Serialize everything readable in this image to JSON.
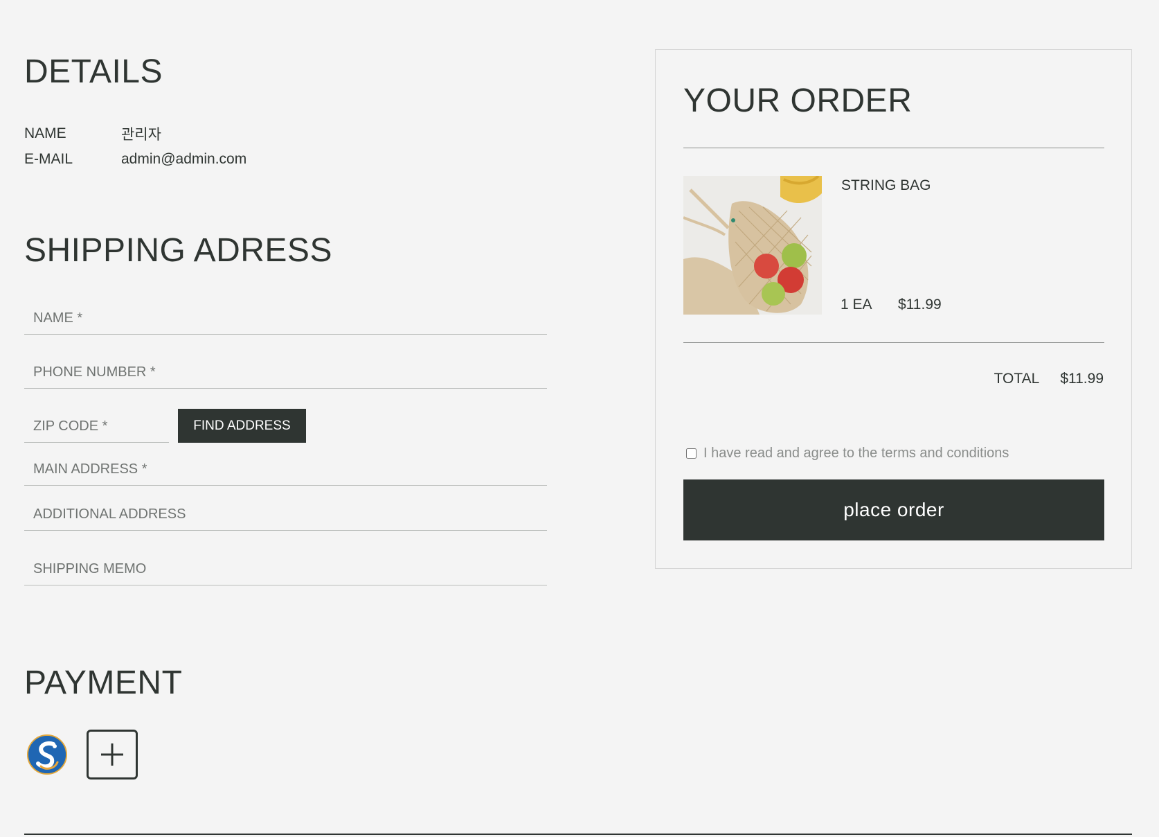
{
  "details": {
    "title": "DETAILS",
    "name_label": "NAME",
    "name_value": "관리자",
    "email_label": "E-MAIL",
    "email_value": "admin@admin.com"
  },
  "shipping": {
    "title": "SHIPPING ADRESS",
    "fields": {
      "name_placeholder": "NAME *",
      "phone_placeholder": "PHONE NUMBER *",
      "zip_placeholder": "ZIP CODE *",
      "main_address_placeholder": "MAIN ADDRESS *",
      "additional_address_placeholder": "ADDITIONAL ADDRESS",
      "memo_placeholder": "SHIPPING MEMO"
    },
    "find_address_label": "FIND ADDRESS"
  },
  "payment": {
    "title": "PAYMENT",
    "methods": [
      {
        "icon": "bank-logo-icon"
      },
      {
        "icon": "plus-icon"
      }
    ]
  },
  "order": {
    "title": "YOUR ORDER",
    "items": [
      {
        "name": "STRING BAG",
        "quantity": "1 EA",
        "price": "$11.99"
      }
    ],
    "total_label": "TOTAL",
    "total_value": "$11.99",
    "terms_label": "I have read and agree to the terms and conditions",
    "place_order_label": "place order"
  },
  "colors": {
    "background": "#f4f4f4",
    "primary": "#2f3532",
    "muted": "#8a8d8b"
  }
}
